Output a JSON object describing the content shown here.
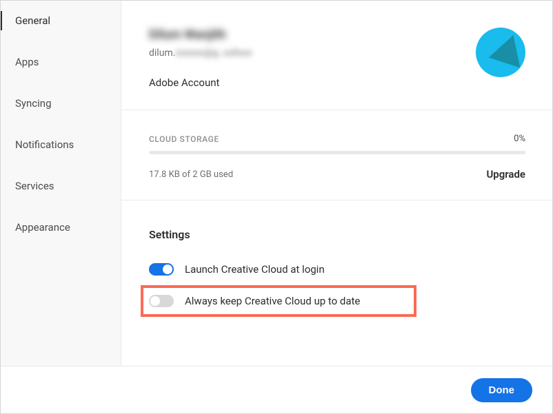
{
  "sidebar": {
    "items": [
      {
        "label": "General",
        "active": true
      },
      {
        "label": "Apps",
        "active": false
      },
      {
        "label": "Syncing",
        "active": false
      },
      {
        "label": "Notifications",
        "active": false
      },
      {
        "label": "Services",
        "active": false
      },
      {
        "label": "Appearance",
        "active": false
      }
    ]
  },
  "account": {
    "name": "Dilum Wanjith",
    "email_prefix": "dilum.",
    "email_suffix": "xxxxxx@g..xxllxxx",
    "link": "Adobe Account"
  },
  "storage": {
    "label": "CLOUD STORAGE",
    "percent": "0%",
    "used_text": "17.8 KB of 2 GB used",
    "upgrade": "Upgrade"
  },
  "settings": {
    "title": "Settings",
    "launch_at_login": {
      "label": "Launch Creative Cloud at login",
      "on": true
    },
    "auto_update": {
      "label": "Always keep Creative Cloud up to date",
      "on": false
    }
  },
  "footer": {
    "done": "Done"
  }
}
